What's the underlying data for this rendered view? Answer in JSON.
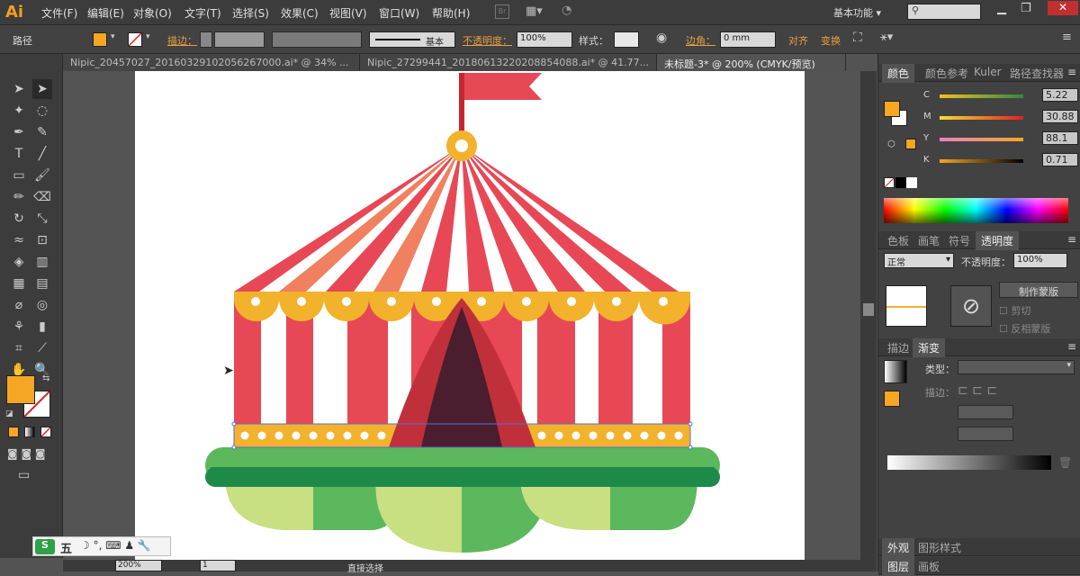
{
  "app": {
    "logo": "Ai",
    "workspace": "基本功能"
  },
  "menu": [
    "文件(F)",
    "编辑(E)",
    "对象(O)",
    "文字(T)",
    "选择(S)",
    "效果(C)",
    "视图(V)",
    "窗口(W)",
    "帮助(H)"
  ],
  "control": {
    "selection": "路径",
    "stroke_label": "描边：",
    "stroke_style": "基本",
    "opacity_label": "不透明度：",
    "opacity_value": "100%",
    "style_label": "样式：",
    "corner_label": "边角：",
    "corner_value": "0 mm",
    "align_label": "对齐",
    "transform_label": "变换",
    "fill_color": "#f5a623"
  },
  "tabs": [
    {
      "label": "Nipic_20457027_20160329102056267000.ai* @ 34% ..."
    },
    {
      "label": "Nipic_27299441_20180613220208854088.ai* @ 41.77..."
    },
    {
      "label": "未标题-3* @ 200% (CMYK/预览)"
    }
  ],
  "color_panel": {
    "tabs": [
      "颜色",
      "颜色参考",
      "Kuler",
      "路径查找器"
    ],
    "channels": [
      {
        "name": "C",
        "value": "5.22"
      },
      {
        "name": "M",
        "value": "30.88"
      },
      {
        "name": "Y",
        "value": "88.1"
      },
      {
        "name": "K",
        "value": "0.71"
      }
    ]
  },
  "transparency_panel": {
    "tabs": [
      "色板",
      "画笔",
      "符号",
      "透明度"
    ],
    "mode": "正常",
    "opacity_label": "不透明度：",
    "opacity_value": "100%",
    "make_mask": "制作蒙版",
    "clip": "剪切",
    "invert": "反相蒙版"
  },
  "gradient_panel": {
    "tabs": [
      "描边",
      "渐变"
    ],
    "type_label": "类型：",
    "stroke_label": "描边："
  },
  "bottom_panel": {
    "tabs": [
      "外观",
      "图形样式"
    ],
    "tabs2": [
      "图层",
      "画板"
    ]
  },
  "status": {
    "zoom": "200%",
    "page": "1",
    "tool": "直接选择"
  },
  "ime": {
    "label": "五"
  },
  "colors": {
    "tent_red": "#e84855",
    "tent_orange": "#f08060",
    "gold": "#f2b22c",
    "green_dark": "#1e8a4a",
    "green": "#5cb85c",
    "green_light": "#c8df82",
    "curtain_dark": "#4a1e2e",
    "curtain_red": "#c0303a"
  }
}
